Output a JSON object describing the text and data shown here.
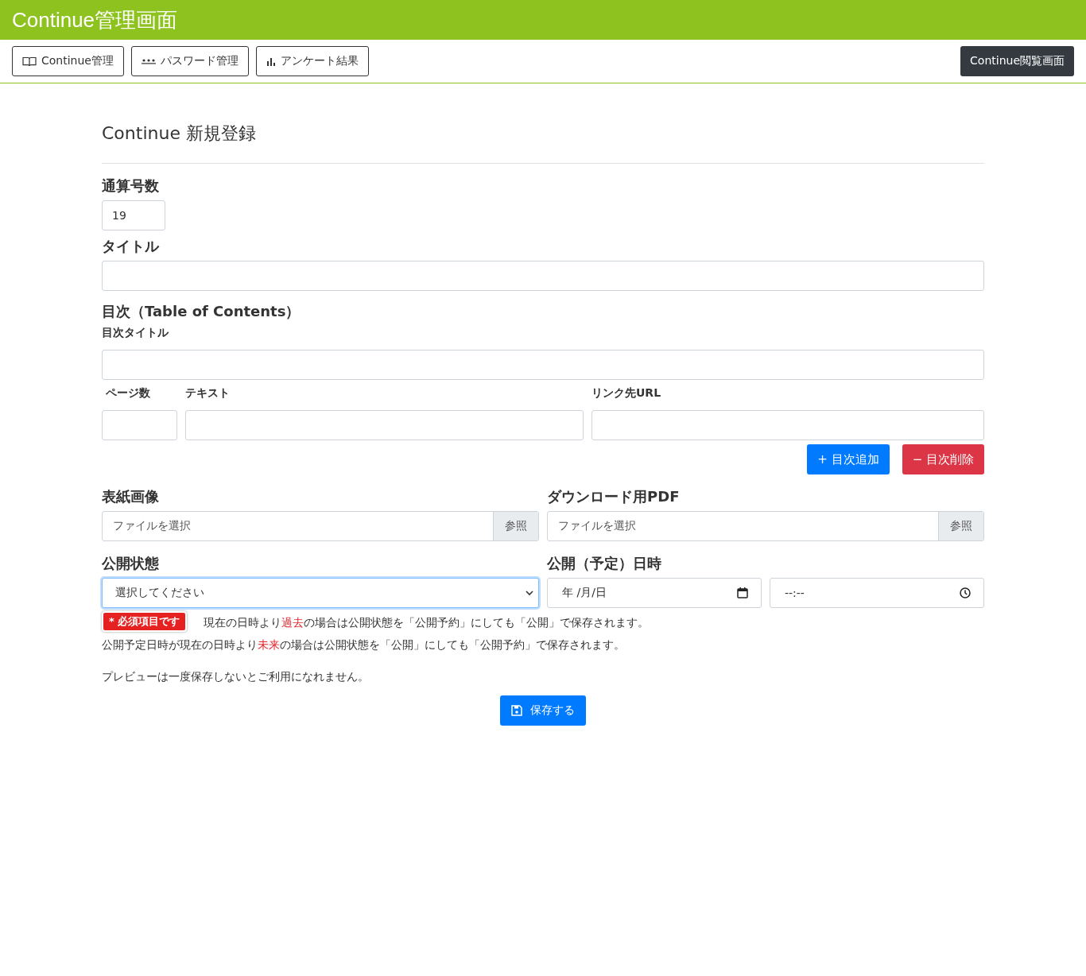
{
  "header": {
    "title": "Continue管理画面"
  },
  "nav": {
    "buttons": [
      {
        "label": "Continue管理"
      },
      {
        "label": "パスワード管理"
      },
      {
        "label": "アンケート結果"
      }
    ],
    "viewer_button": "Continue閲覧画面"
  },
  "form": {
    "heading": "Continue 新規登録",
    "issue_number": {
      "label": "通算号数",
      "value": "19"
    },
    "title": {
      "label": "タイトル"
    },
    "toc": {
      "heading": "目次（Table of Contents）",
      "title_label": "目次タイトル",
      "columns": [
        "ページ数",
        "テキスト",
        "リンク先URL"
      ],
      "add_button": "+ 目次追加",
      "remove_button": "− 目次削除"
    },
    "files": [
      {
        "label": "表紙画像",
        "placeholder": "ファイルを選択",
        "browse": "参照"
      },
      {
        "label": "ダウンロード用PDF",
        "placeholder": "ファイルを選択",
        "browse": "参照"
      }
    ],
    "status": {
      "label": "公開状態",
      "value": "選択してください",
      "focused": true,
      "error": "* 必須項目です"
    },
    "datetime": {
      "label": "公開（予定）日時",
      "date": "年 /月/日",
      "time": "--:--"
    },
    "notes": [
      {
        "parts": [
          {
            "text": "現在の日時より",
            "highlight": false
          },
          {
            "text": "過去",
            "highlight": true
          },
          {
            "text": "の場合は公開状態を「公開予約」にしても「公開」で保存されます。",
            "highlight": false
          }
        ]
      },
      {
        "parts": [
          {
            "text": "公開予定日時が現在の日時より",
            "highlight": false
          },
          {
            "text": "未来",
            "highlight": true
          },
          {
            "text": "の場合は公開状態を「公開」にしても「公開予約」で保存されます。",
            "highlight": false
          }
        ]
      }
    ],
    "preview_note": "プレビューは一度保存しないとご利用になれません。",
    "save_button": "保存する"
  }
}
